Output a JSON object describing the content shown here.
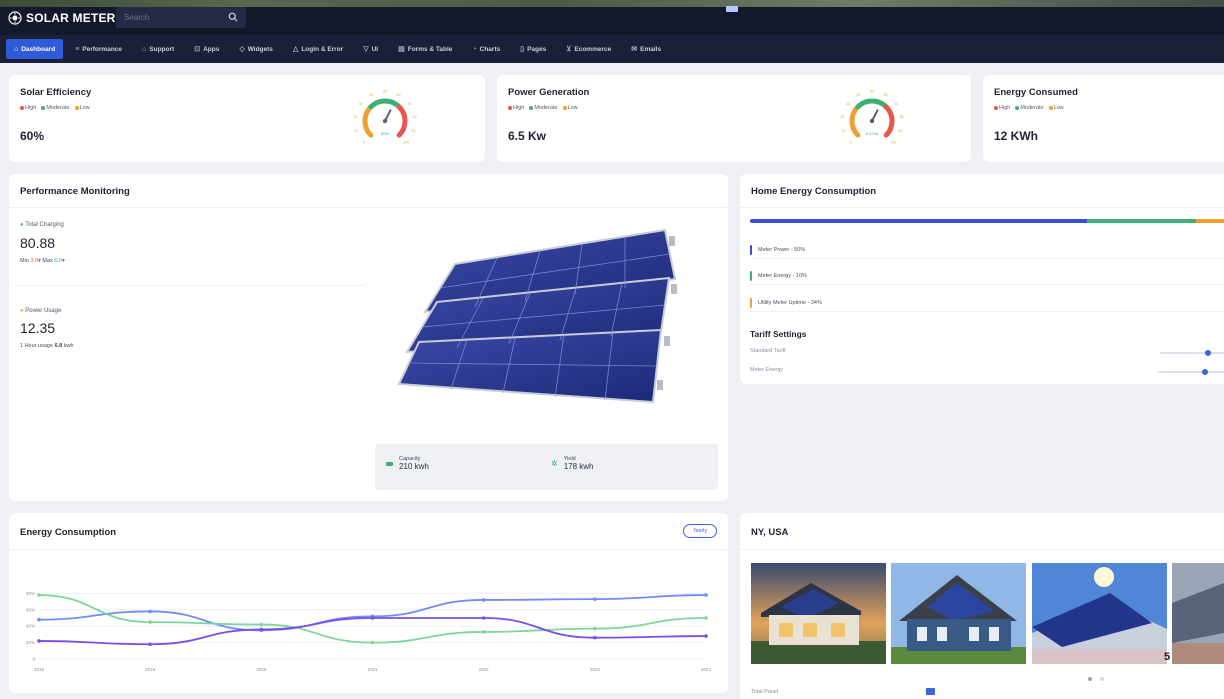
{
  "app": {
    "name": "SOLAR METER"
  },
  "search": {
    "placeholder": "Search"
  },
  "nav": [
    {
      "label": "Dashboard",
      "icon": "home-icon",
      "glyph": "⌂",
      "active": true
    },
    {
      "label": "Performance",
      "icon": "performance-icon",
      "glyph": "≡"
    },
    {
      "label": "Support",
      "icon": "support-icon",
      "glyph": "⌂"
    },
    {
      "label": "Apps",
      "icon": "apps-icon",
      "glyph": "⊡"
    },
    {
      "label": "Widgets",
      "icon": "widgets-icon",
      "glyph": "◇"
    },
    {
      "label": "Login & Error",
      "icon": "login-icon",
      "glyph": "△"
    },
    {
      "label": "UI",
      "icon": "ui-icon",
      "glyph": "▽"
    },
    {
      "label": "Forms & Table",
      "icon": "forms-icon",
      "glyph": "▤"
    },
    {
      "label": "Charts",
      "icon": "charts-icon",
      "glyph": "◔"
    },
    {
      "label": "Pages",
      "icon": "pages-icon",
      "glyph": "▯"
    },
    {
      "label": "Ecommerce",
      "icon": "cart-icon",
      "glyph": "⊻"
    },
    {
      "label": "Emails",
      "icon": "mail-icon",
      "glyph": "✉"
    }
  ],
  "kpis": [
    {
      "title": "Solar Efficiency",
      "legend": [
        "High",
        "Moderate",
        "Low"
      ],
      "value": "60%",
      "gauge_fraction": 0.6,
      "gauge_ticks": [
        "0",
        "10",
        "20",
        "30",
        "40",
        "50",
        "60",
        "70",
        "80",
        "90",
        "100"
      ]
    },
    {
      "title": "Power Generation",
      "legend": [
        "High",
        "Moderate",
        "Low"
      ],
      "value": "6.5 Kw",
      "gauge_fraction": 0.6,
      "gauge_ticks": [
        "0",
        "10",
        "20",
        "30",
        "40",
        "50",
        "60",
        "70",
        "80",
        "90",
        "100"
      ]
    },
    {
      "title": "Energy Consumed",
      "legend": [
        "High",
        "Moderate",
        "Low"
      ],
      "value": "12 KWh"
    }
  ],
  "legend_colors": {
    "high": "#e8574a",
    "moderate": "#3bb273",
    "low": "#f0a030"
  },
  "performance": {
    "title": "Performance Monitoring",
    "total_charging": {
      "label": "Total Charging",
      "value": "80.88",
      "min_label": "Min",
      "min_value": "3.0",
      "max_label": "Max",
      "max_value": "6.0"
    },
    "power_usage": {
      "label": "Power Usage",
      "value": "12.35",
      "usage_label": "1 Hour usage",
      "usage_value": "6.8",
      "usage_unit": "kwh"
    },
    "capacity": {
      "label": "Capacity",
      "value": "210 kwh"
    },
    "yield": {
      "label": "Yield",
      "value": "178 kwh"
    }
  },
  "home_energy": {
    "title": "Home Energy Consumption",
    "segments": [
      {
        "color": "#3550d4",
        "fraction": 0.71
      },
      {
        "color": "#3bb273",
        "fraction": 0.23
      },
      {
        "color": "#f0a030",
        "fraction": 0.06
      }
    ],
    "items": [
      {
        "label": "Meter Power - 50%",
        "color": "#3550d4"
      },
      {
        "label": "Meter Energy - 10%",
        "color": "#3bb273"
      },
      {
        "label": "Utility Meter Uptime - 34%",
        "color": "#f0a030"
      }
    ],
    "tariff": {
      "title": "Tariff Settings",
      "rows": [
        {
          "label": "Standard Tariff"
        },
        {
          "label": "Meter Energy"
        }
      ]
    }
  },
  "energy_chart": {
    "title": "Energy Consumption",
    "period_button": "Yearly"
  },
  "chart_data": {
    "type": "line",
    "x": [
      "2018",
      "2019",
      "2020",
      "2021",
      "2022",
      "2023",
      "2024"
    ],
    "ylim": [
      0,
      100
    ],
    "y_ticks": [
      "0",
      "20%",
      "40%",
      "60%",
      "80%"
    ],
    "series": [
      {
        "color": "#6f8ef5",
        "values": [
          48,
          58,
          35,
          52,
          72,
          73,
          78
        ]
      },
      {
        "color": "#7fd69a",
        "values": [
          78,
          45,
          42,
          20,
          33,
          37,
          50
        ]
      },
      {
        "color": "#7a4ee8",
        "values": [
          22,
          18,
          36,
          50,
          50,
          26,
          28
        ]
      }
    ]
  },
  "location": {
    "title": "NY, USA",
    "photo_count": "5",
    "footer_label": "Total Panel"
  }
}
